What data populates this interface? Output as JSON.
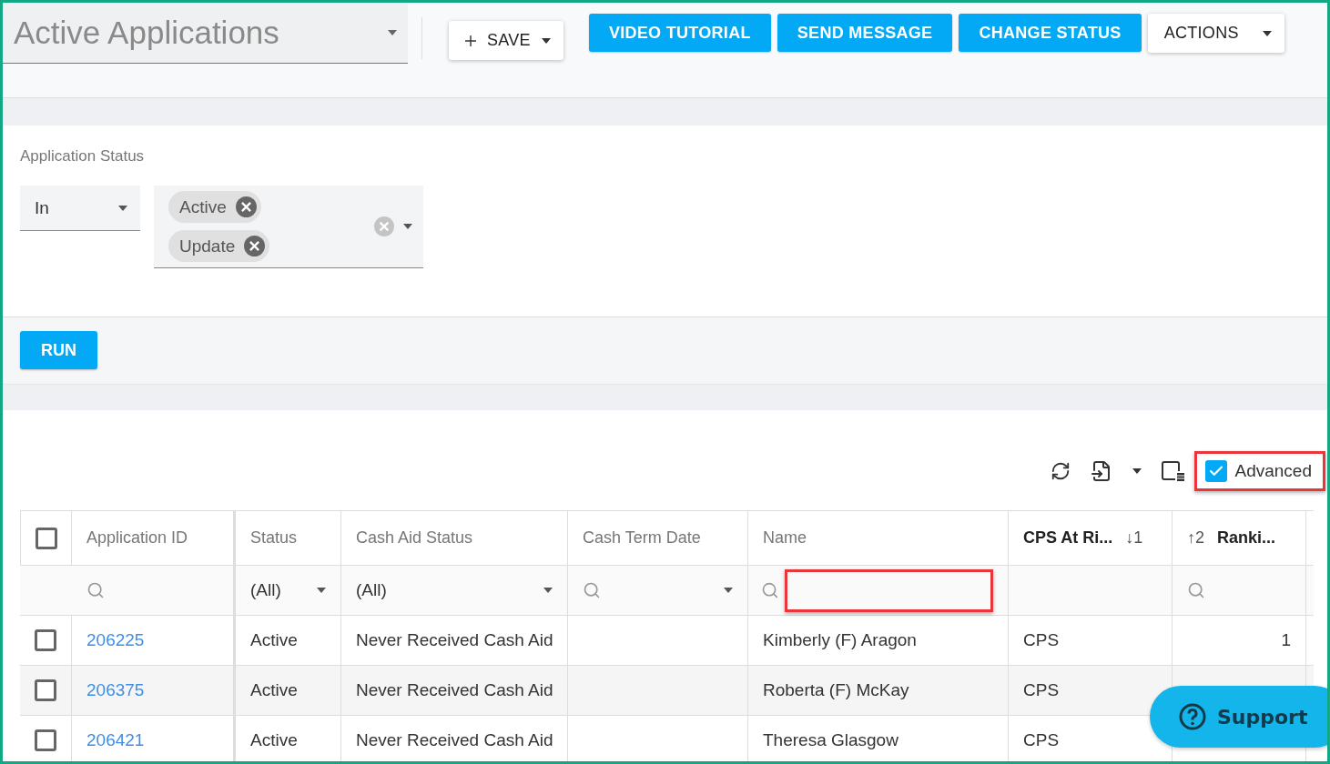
{
  "view_selector": {
    "value": "Active Applications"
  },
  "toolbar": {
    "buttons": [
      {
        "label": "SAVE",
        "kind": "save"
      },
      {
        "label": "VIDEO TUTORIAL",
        "kind": "primary"
      },
      {
        "label": "SEND MESSAGE",
        "kind": "primary"
      },
      {
        "label": "CHANGE STATUS",
        "kind": "primary"
      },
      {
        "label": "ACTIONS",
        "kind": "menu"
      }
    ]
  },
  "filter": {
    "label": "Application Status",
    "operator": "In",
    "tags": [
      "Active",
      "Update"
    ]
  },
  "run_button": {
    "label": "RUN"
  },
  "grid": {
    "advanced": {
      "label": "Advanced",
      "checked": true,
      "highlighted": true
    },
    "select_all": {
      "checked": false
    },
    "columns": [
      {
        "kind": "link",
        "header": [
          {
            "kind": "label",
            "text": "Application ID"
          }
        ],
        "filter": {
          "kind": "search"
        }
      },
      {
        "kind": "text",
        "header": [
          {
            "kind": "label",
            "text": "Status"
          }
        ],
        "filter": {
          "kind": "select",
          "value": "(All)"
        }
      },
      {
        "kind": "text",
        "header": [
          {
            "kind": "label",
            "text": "Cash Aid Status"
          }
        ],
        "filter": {
          "kind": "select",
          "value": "(All)"
        }
      },
      {
        "kind": "text",
        "header": [
          {
            "kind": "label",
            "text": "Cash Term Date"
          }
        ],
        "filter": {
          "kind": "search-select"
        }
      },
      {
        "kind": "text",
        "header": [
          {
            "kind": "label",
            "text": "Name"
          }
        ],
        "filter": {
          "kind": "search-input",
          "highlighted": true
        }
      },
      {
        "kind": "text",
        "header": [
          {
            "kind": "sorted-label",
            "text": "CPS At Ri..."
          },
          {
            "kind": "sort",
            "text": "↓1"
          }
        ],
        "filter": {
          "kind": "none"
        }
      },
      {
        "kind": "number",
        "header": [
          {
            "kind": "sort",
            "text": "↑2"
          },
          {
            "kind": "sorted-label",
            "text": "Ranki..."
          }
        ],
        "filter": {
          "kind": "search"
        }
      }
    ],
    "rows": [
      {
        "checked": false,
        "cells": [
          "206225",
          "Active",
          "Never Received Cash Aid",
          null,
          "Kimberly (F) Aragon",
          "CPS",
          "1"
        ]
      },
      {
        "checked": false,
        "cells": [
          "206375",
          "Active",
          "Never Received Cash Aid",
          null,
          "Roberta (F) McKay",
          "CPS"
        ]
      },
      {
        "checked": false,
        "cells": [
          "206421",
          "Active",
          "Never Received Cash Aid",
          null,
          "Theresa Glasgow",
          "CPS"
        ]
      }
    ]
  },
  "support": {
    "label": "Support"
  }
}
